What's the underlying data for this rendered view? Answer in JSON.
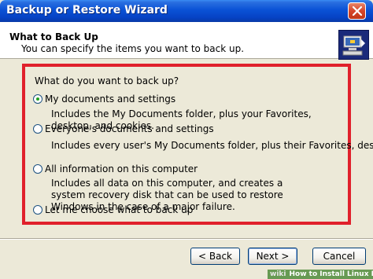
{
  "window": {
    "title": "Backup or Restore Wizard",
    "close_icon": "close-icon"
  },
  "header": {
    "title": "What to Back Up",
    "subtitle": "You can specify the items you want to back up.",
    "icon": "backup-wizard-icon"
  },
  "content": {
    "question": "What do you want to back up?",
    "highlight_color": "#e0202b",
    "options": [
      {
        "label": "My documents and settings",
        "selected": true,
        "description": "Includes the My Documents folder, plus your Favorites, desktop, and cookies."
      },
      {
        "label": "Everyone's documents and settings",
        "selected": false,
        "description": "Includes every user's My Documents folder, plus their Favorites, desktop, and cookies."
      },
      {
        "label": "All information on this computer",
        "selected": false,
        "description": "Includes all data on this computer, and creates a system recovery disk that can be used to restore Windows in the case of a major failure."
      },
      {
        "label": "Let me choose what to back up",
        "selected": false,
        "description": ""
      }
    ]
  },
  "buttons": {
    "back": "< Back",
    "next": "Next >",
    "cancel": "Cancel"
  },
  "watermark": {
    "brand": "wiki",
    "text": "How to Install Linux Mint"
  }
}
